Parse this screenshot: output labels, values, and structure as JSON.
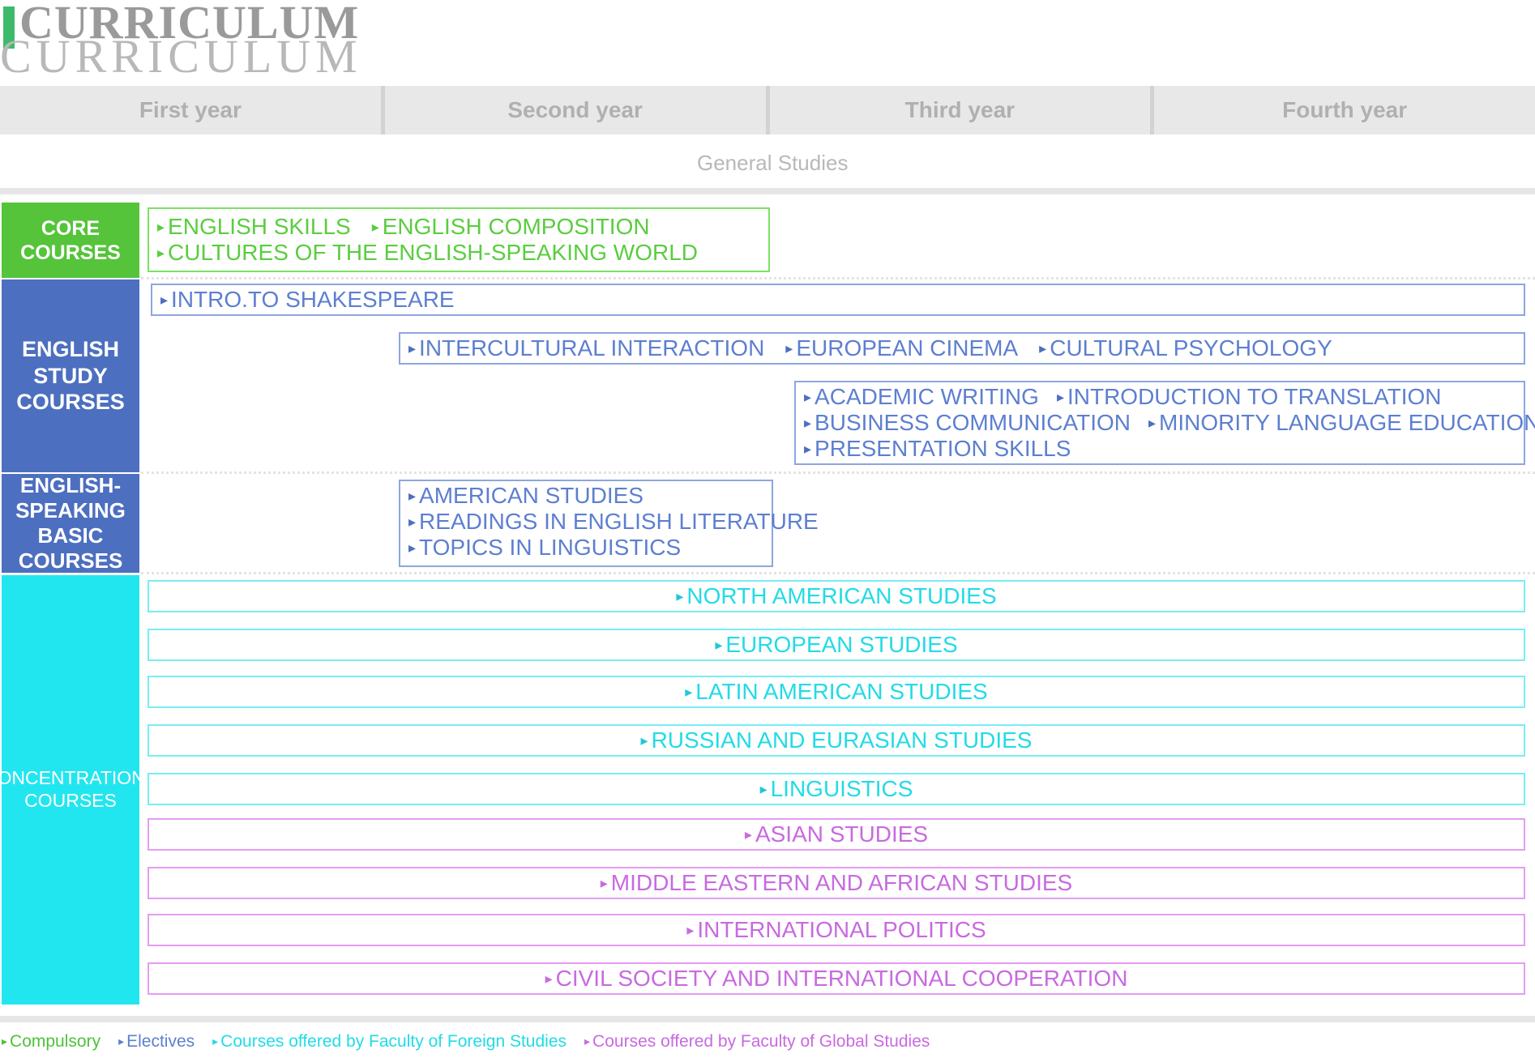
{
  "title": "CURRICULUM",
  "years": [
    "First year",
    "Second year",
    "Third year",
    "Fourth year"
  ],
  "general_studies": "General Studies",
  "categories": {
    "core": "CORE\nCOURSES",
    "english_study": "ENGLISH\nSTUDY\nCOURSES",
    "english_speaking_basic": "ENGLISH-\nSPEAKING\nBASIC\nCOURSES",
    "concentrations": "CONCENTRATIONS\nCOURSES"
  },
  "core_courses": [
    "ENGLISH SKILLS",
    "ENGLISH COMPOSITION",
    "CULTURES OF THE ENGLISH-SPEAKING WORLD"
  ],
  "english_study_courses": {
    "row1": [
      "INTRO.TO SHAKESPEARE"
    ],
    "row2": [
      "INTERCULTURAL INTERACTION",
      "EUROPEAN CINEMA",
      "CULTURAL PSYCHOLOGY"
    ],
    "row3": [
      "ACADEMIC WRITING",
      "INTRODUCTION TO TRANSLATION",
      "BUSINESS COMMUNICATION",
      "MINORITY LANGUAGE EDUCATION",
      "PRESENTATION SKILLS"
    ]
  },
  "basic_courses": [
    "AMERICAN STUDIES",
    "READINGS IN ENGLISH LITERATURE",
    "TOPICS IN LINGUISTICS"
  ],
  "concentrations_foreign": [
    "NORTH AMERICAN STUDIES",
    "EUROPEAN STUDIES",
    "LATIN AMERICAN STUDIES",
    "RUSSIAN AND EURASIAN STUDIES",
    "LINGUISTICS"
  ],
  "concentrations_global": [
    "ASIAN STUDIES",
    "MIDDLE EASTERN AND AFRICAN STUDIES",
    "INTERNATIONAL POLITICS",
    "CIVIL SOCIETY AND INTERNATIONAL COOPERATION"
  ],
  "legend": {
    "compulsory": "Compulsory",
    "electives": "Electives",
    "foreign": "Courses offered by Faculty of Foreign Studies",
    "global": "Courses offered by Faculty of Global Studies"
  },
  "colors": {
    "core_green": "#55c43a",
    "study_blue": "#4d6fc0",
    "concentration_cyan": "#22e6ef",
    "global_pink": "#c86ae0"
  }
}
